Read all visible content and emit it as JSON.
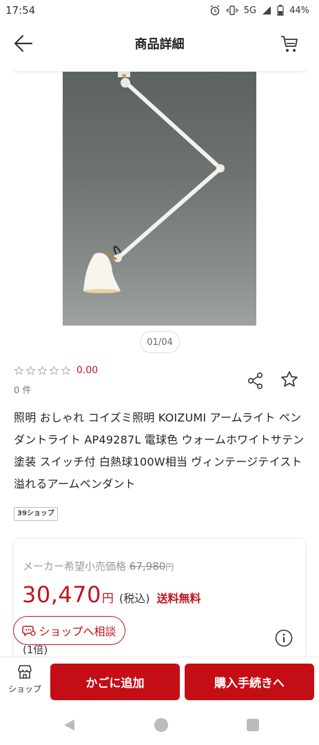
{
  "status_bar": {
    "time": "17:54",
    "network": "5G",
    "battery": "44%"
  },
  "header": {
    "title": "商品詳細"
  },
  "gallery": {
    "pager": "01/04"
  },
  "rating": {
    "value": "0.00",
    "stars": 0,
    "count": "0 件"
  },
  "product": {
    "title": "照明 おしゃれ コイズミ照明 KOIZUMI アームライト ペンダントライト AP49287L 電球色 ウォームホワイトサテン塗装 スイッチ付 白熱球100W相当 ヴィンテージテイスト溢れるアームペンダント",
    "shop_tag": "39ショップ"
  },
  "price": {
    "msrp_label": "メーカー希望小売価格",
    "msrp_value": "67,980",
    "msrp_unit": "円",
    "value": "30,470",
    "unit": "円",
    "tax_label": "(税込)",
    "shipping_label": "送料無料",
    "consult_label": "ショップへ相談",
    "quantity_note": "(1倍)"
  },
  "bottom_bar": {
    "shop_label": "ショップ",
    "add_to_cart_label": "かごに追加",
    "buy_label": "購入手続きへ"
  },
  "colors": {
    "accent": "#c40d15",
    "price": "#c0141c"
  }
}
